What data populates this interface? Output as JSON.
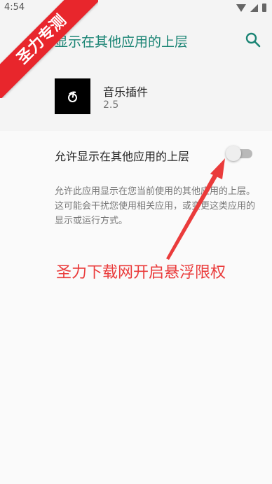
{
  "status_bar": {
    "time": "4:54",
    "icons": [
      "wifi-icon",
      "signal-icon",
      "battery-icon"
    ]
  },
  "app_bar": {
    "title": "显示在其他应用的上层",
    "search_icon": "search-icon"
  },
  "app_info": {
    "name": "音乐插件",
    "version": "2.5",
    "icon": "music-app-icon"
  },
  "permission": {
    "toggle_label": "允许显示在其他应用的上层",
    "toggle_state": "off",
    "description": "允许此应用显示在您当前使用的其他应用的上层。这可能会干扰您使用相关应用，或变更这类应用的显示或运行方式。"
  },
  "annotation": {
    "text": "圣力下载网开启悬浮限权",
    "color": "#ea3b3b"
  },
  "watermark": {
    "text": "圣力专测",
    "color": "#e8262c"
  },
  "colors": {
    "accent": "#1a8474",
    "background": "#fafafa",
    "header_background": "#f4f4f4"
  }
}
